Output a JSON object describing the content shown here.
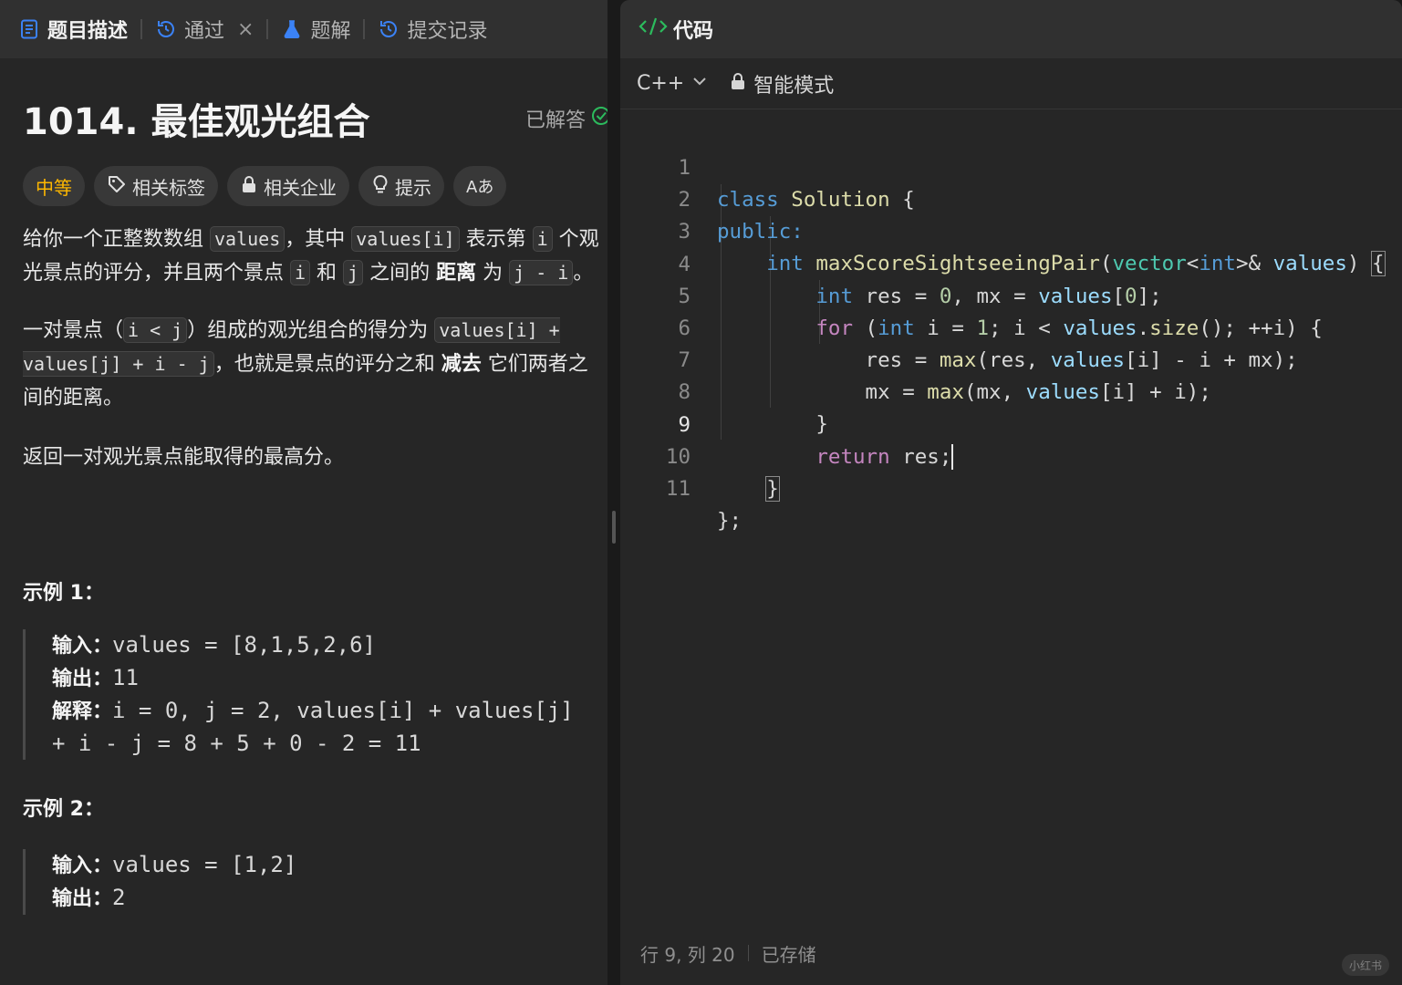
{
  "left_tabs": [
    {
      "label": "题目描述",
      "active": true
    },
    {
      "label": "通过",
      "close": "×"
    },
    {
      "label": "题解"
    },
    {
      "label": "提交记录"
    }
  ],
  "problem": {
    "title": "1014. 最佳观光组合",
    "status": "已解答",
    "difficulty": "中等",
    "tags": [
      "相关标签",
      "相关企业",
      "提示",
      "Aあ"
    ]
  },
  "description": {
    "p1": [
      "给你一个正整数数组 ",
      "values",
      "，其中 ",
      "values[i]",
      " 表示第 ",
      "i",
      " 个观光景点的评分，并且两个景点 ",
      "i",
      " 和 ",
      "j",
      " 之间的 ",
      "距离",
      " 为 ",
      "j - i",
      "。"
    ],
    "p2": [
      "一对景点（",
      "i < j",
      "）组成的观光组合的得分为 ",
      "values[i] + values[j] + i - j",
      "，也就是景点的评分之和 ",
      "减去",
      " 它们两者之间的距离。"
    ],
    "p3": "返回一对观光景点能取得的最高分。"
  },
  "examples": [
    {
      "title": "示例 1：",
      "lines": [
        {
          "label": "输入：",
          "text": "values = [8,1,5,2,6]"
        },
        {
          "label": "输出：",
          "text": "11"
        },
        {
          "label": "解释：",
          "text": "i = 0, j = 2, values[i] + values[j]"
        },
        {
          "label": "",
          "text": "+ i - j = 8 + 5 + 0 - 2 = 11"
        }
      ]
    },
    {
      "title": "示例 2：",
      "lines": [
        {
          "label": "输入：",
          "text": "values = [1,2]"
        },
        {
          "label": "输出：",
          "text": "2"
        }
      ]
    }
  ],
  "editor": {
    "header": "代码",
    "language": "C++",
    "mode": "智能模式",
    "current_line": 9,
    "lines": [
      "class Solution {",
      "public:",
      "    int maxScoreSightseeingPair(vector<int>& values) {",
      "        int res = 0, mx = values[0];",
      "        for (int i = 1; i < values.size(); ++i) {",
      "            res = max(res, values[i] - i + mx);",
      "            mx = max(mx, values[i] + i);",
      "        }",
      "        return res;",
      "    }",
      "};"
    ],
    "status_position": "行 9, 列 20",
    "status_saved": "已存储"
  },
  "watermark": "小红书",
  "colors": {
    "difficulty": "#ffb800",
    "solved_check": "#2cbb5d",
    "keyword": "#569cd6",
    "control": "#c586c0",
    "function": "#dcdcaa",
    "variable": "#9cdcfe"
  }
}
